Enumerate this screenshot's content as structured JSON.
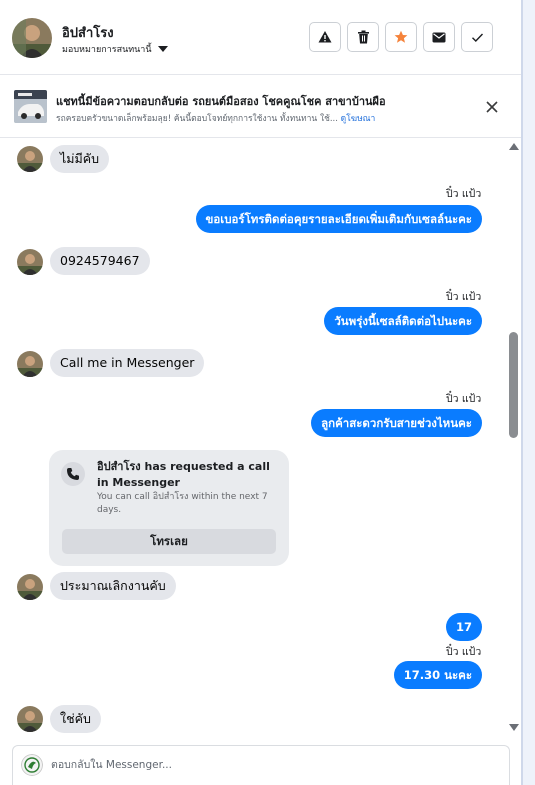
{
  "header": {
    "name": "อิปสำโรง",
    "assign_label": "มอบหมายการสนทนานี้",
    "actions": [
      "warning-icon",
      "trash-icon",
      "star-icon",
      "envelope-icon",
      "checkmark-icon"
    ]
  },
  "post": {
    "title": "แชทนี้มีข้อความตอบกลับต่อ รถยนต์มือสอง โชคคูณโชค สาขาบ้านผือ",
    "subtitle": "รถครอบครัวขนาดเล็กพร้อมลุย! ค้นนี้ตอบโจทย์ทุกการใช้งาน ทั้งทนทาน ใช้... ",
    "link": "ดูโฆษณา"
  },
  "messages": {
    "m1": "ไม่มีคับ",
    "seen1": "ปิ๋ว แป้ว",
    "r1": "ขอเบอร์โทรติดต่อคุยรายละเอียดเพิ่มเติมกับเซลล์นะคะ",
    "m2": "0924579467",
    "seen2": "ปิ๋ว แป้ว",
    "r2": "วันพรุ่งนี้เซลล์ติดต่อไปนะคะ",
    "m3": "Call me in Messenger",
    "seen3": "ปิ๋ว แป้ว",
    "r3": "ลูกค้าสะดวกรับสายช่วงไหนคะ",
    "call": {
      "title_name": "อิปสำโรง",
      "title_rest": " has requested a call in Messenger",
      "desc": "You can call อิปสำโรง within the next 7 days.",
      "button": "โทรเลย"
    },
    "m4": "ประมาณเลิกงานคับ",
    "r4": "17",
    "seen4": "ปิ๋ว แป้ว",
    "r5": "17.30  นะคะ",
    "m5": "ใช่คับ"
  },
  "composer": {
    "placeholder": "ตอบกลับใน Messenger..."
  },
  "colors": {
    "accent": "#0a7cff",
    "incoming_bubble": "#e4e6eb",
    "star": "#f5833b"
  }
}
